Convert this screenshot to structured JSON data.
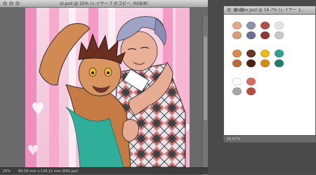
{
  "main_window": {
    "title": "st.psd @ 25% (レイヤー 7 のコピー, RGB/8)",
    "status_zoom": "25%",
    "status_doc": "89.58 mm x 134.11 mm (600 ppi)"
  },
  "palette_window": {
    "title": "stcolor.psd @ 16.7% (レイヤー 1...",
    "status_zoom": "16.67%"
  },
  "colors": {
    "swatches": [
      {
        "name": "skin-peach",
        "hex": "#e8a98a"
      },
      {
        "name": "lavender-gray",
        "hex": "#8f8fae"
      },
      {
        "name": "rust-red",
        "hex": "#b1504b"
      },
      {
        "name": "off-white",
        "hex": "#e7e4ea"
      },
      {
        "name": "tan",
        "hex": "#d49c7a"
      },
      {
        "name": "slate-blue",
        "hex": "#6e6e92"
      },
      {
        "name": "dark-red",
        "hex": "#8e3b34"
      },
      {
        "name": "gray",
        "hex": "#c9c6cc"
      },
      {
        "name": "orange-skin",
        "hex": "#d9894d"
      },
      {
        "name": "brown",
        "hex": "#6a3628"
      },
      {
        "name": "gold",
        "hex": "#f1b71e"
      },
      {
        "name": "teal",
        "hex": "#2fa38a"
      },
      {
        "name": "caramel",
        "hex": "#c26a3a"
      },
      {
        "name": "dark-brown",
        "hex": "#4b2419"
      },
      {
        "name": "amber",
        "hex": "#d68b13"
      },
      {
        "name": "dark-teal",
        "hex": "#1f7f6c"
      },
      {
        "name": "white",
        "hex": "#ffffff"
      },
      {
        "name": "salmon",
        "hex": "#d86a60"
      },
      {
        "name": "silver",
        "hex": "#a6a5a8"
      },
      {
        "name": "brick",
        "hex": "#bb4b44"
      }
    ]
  }
}
